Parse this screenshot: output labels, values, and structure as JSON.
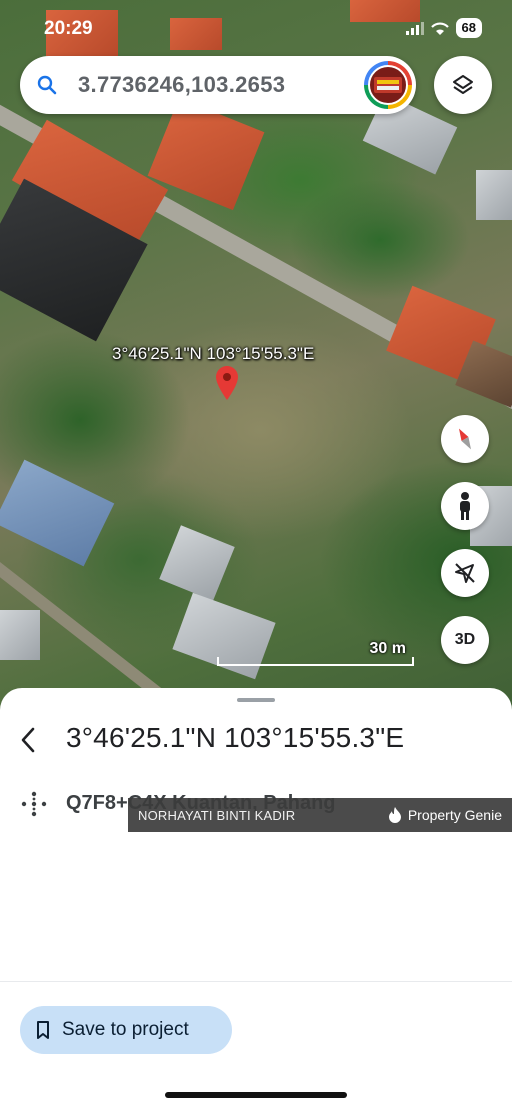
{
  "status_bar": {
    "time": "20:29",
    "battery": "68"
  },
  "search": {
    "query": "3.7736246,103.2653"
  },
  "map": {
    "pin_label": "3°46'25.1\"N 103°15'55.3\"E",
    "scale_label": "30 m",
    "controls": {
      "three_d_label": "3D"
    }
  },
  "sheet": {
    "title": "3°46'25.1\"N 103°15'55.3\"E",
    "plus_code": "Q7F8+C4X Kuantan, Pahang",
    "save_label": "Save to project"
  },
  "watermark": {
    "agent": "NORHAYATI BINTI KADIR",
    "brand": "Property Genie"
  },
  "colors": {
    "pin": "#e53935",
    "save_button_bg": "#c8e0f7",
    "search_icon": "#1a73e8"
  },
  "icons": [
    "search-icon",
    "layers-icon",
    "compass-icon",
    "pegman-icon",
    "navigation-off-icon",
    "back-arrow-icon",
    "plus-code-icon",
    "bookmark-icon",
    "flame-icon"
  ]
}
